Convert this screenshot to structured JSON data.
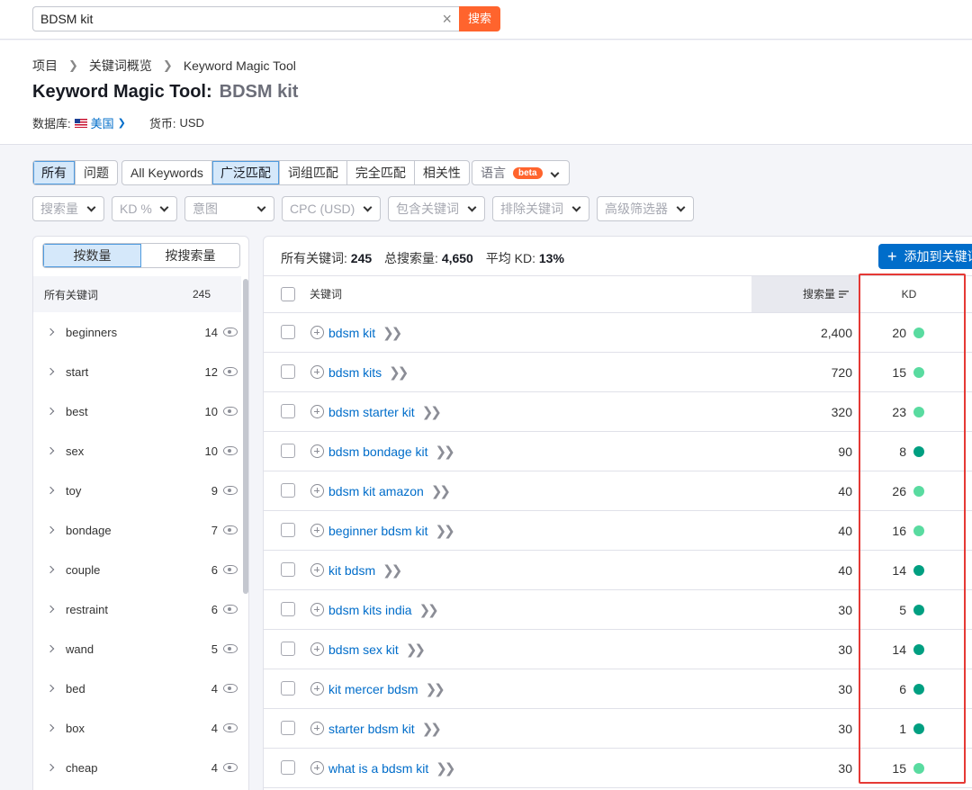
{
  "search": {
    "value": "BDSM kit",
    "button": "搜索"
  },
  "breadcrumb": [
    "项目",
    "关键词概览",
    "Keyword Magic Tool"
  ],
  "title": {
    "prefix": "Keyword Magic Tool:",
    "keyword": "BDSM kit"
  },
  "meta": {
    "database_label": "数据库:",
    "database_value": "美国",
    "currency_label": "货币:",
    "currency_value": "USD"
  },
  "filters": {
    "group1": [
      "所有",
      "问题"
    ],
    "group2": [
      "All Keywords",
      "广泛匹配",
      "词组匹配",
      "完全匹配",
      "相关性"
    ],
    "language": "语言",
    "beta": "beta",
    "dropdowns": [
      "搜索量",
      "KD %",
      "意图",
      "CPC (USD)",
      "包含关键词",
      "排除关键词",
      "高级筛选器"
    ]
  },
  "left_panel": {
    "toggle": [
      "按数量",
      "按搜索量"
    ],
    "all_label": "所有关键词",
    "all_count": "245",
    "groups": [
      {
        "name": "beginners",
        "count": "14"
      },
      {
        "name": "start",
        "count": "12"
      },
      {
        "name": "best",
        "count": "10"
      },
      {
        "name": "sex",
        "count": "10"
      },
      {
        "name": "toy",
        "count": "9"
      },
      {
        "name": "bondage",
        "count": "7"
      },
      {
        "name": "couple",
        "count": "6"
      },
      {
        "name": "restraint",
        "count": "6"
      },
      {
        "name": "wand",
        "count": "5"
      },
      {
        "name": "bed",
        "count": "4"
      },
      {
        "name": "box",
        "count": "4"
      },
      {
        "name": "cheap",
        "count": "4"
      }
    ]
  },
  "table": {
    "stats": {
      "all_label": "所有关键词:",
      "all_value": "245",
      "vol_label": "总搜索量:",
      "vol_value": "4,650",
      "kd_label": "平均 KD:",
      "kd_value": "13%"
    },
    "add_button": "添加到关键词",
    "headers": {
      "keyword": "关键词",
      "volume": "搜索量",
      "kd": "KD"
    },
    "colors": {
      "light": "#59dba0",
      "dark": "#009f81"
    },
    "rows": [
      {
        "keyword": "bdsm kit",
        "volume": "2,400",
        "kd": "20",
        "level": "light"
      },
      {
        "keyword": "bdsm kits",
        "volume": "720",
        "kd": "15",
        "level": "light"
      },
      {
        "keyword": "bdsm starter kit",
        "volume": "320",
        "kd": "23",
        "level": "light"
      },
      {
        "keyword": "bdsm bondage kit",
        "volume": "90",
        "kd": "8",
        "level": "dark"
      },
      {
        "keyword": "bdsm kit amazon",
        "volume": "40",
        "kd": "26",
        "level": "light"
      },
      {
        "keyword": "beginner bdsm kit",
        "volume": "40",
        "kd": "16",
        "level": "light"
      },
      {
        "keyword": "kit bdsm",
        "volume": "40",
        "kd": "14",
        "level": "dark"
      },
      {
        "keyword": "bdsm kits india",
        "volume": "30",
        "kd": "5",
        "level": "dark"
      },
      {
        "keyword": "bdsm sex kit",
        "volume": "30",
        "kd": "14",
        "level": "dark"
      },
      {
        "keyword": "kit mercer bdsm",
        "volume": "30",
        "kd": "6",
        "level": "dark"
      },
      {
        "keyword": "starter bdsm kit",
        "volume": "30",
        "kd": "1",
        "level": "dark"
      },
      {
        "keyword": "what is a bdsm kit",
        "volume": "30",
        "kd": "15",
        "level": "light"
      }
    ]
  }
}
